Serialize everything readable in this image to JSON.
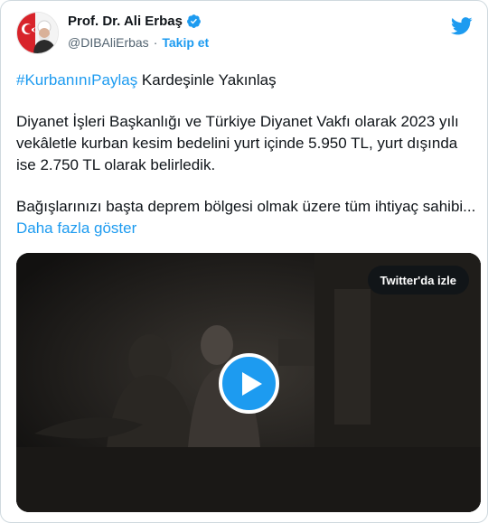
{
  "author": {
    "display_name": "Prof. Dr. Ali Erbaş",
    "handle": "@DIBAliErbas",
    "separator": "·",
    "follow_label": "Takip et",
    "verified_icon": "verified-badge-icon",
    "avatar": "profile-avatar"
  },
  "brand": {
    "logo": "twitter-bird-icon",
    "color": "#1d9bf0"
  },
  "tweet": {
    "hashtag": "#KurbanınıPaylaş",
    "headline_rest": " Kardeşinle Yakınlaş",
    "paragraph_2": "Diyanet İşleri Başkanlığı ve Türkiye Diyanet Vakfı olarak 2023 yılı vekâletle kurban kesim bedelini yurt içinde 5.950 TL, yurt dışında ise 2.750 TL olarak belirledik.",
    "paragraph_3": "Bağışlarınızı başta deprem bölgesi olmak üzere tüm ihtiyaç sahibi...",
    "show_more_label": "Daha fazla göster"
  },
  "media": {
    "type": "video",
    "watch_label": "Twitter'da izle",
    "play_icon": "play-icon"
  },
  "colors": {
    "text": "#0f1419",
    "muted": "#536471",
    "accent": "#1d9bf0",
    "border": "#cfd9de"
  }
}
